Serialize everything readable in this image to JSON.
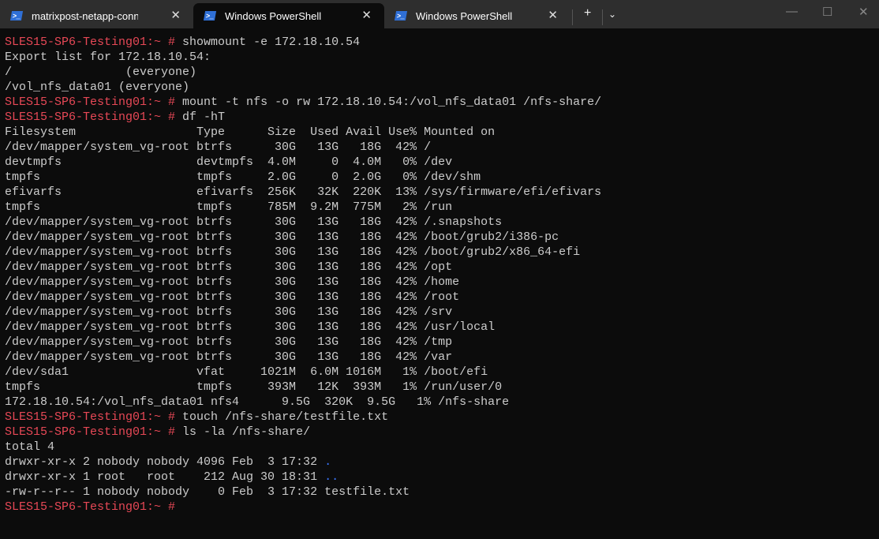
{
  "tabs": [
    {
      "label": "matrixpost-netapp-connector(",
      "active": false
    },
    {
      "label": "Windows PowerShell",
      "active": true
    },
    {
      "label": "Windows PowerShell",
      "active": false
    }
  ],
  "colors": {
    "prompt": "#e74856",
    "dir": "#3b78ff",
    "text": "#cccccc",
    "bg": "#0c0c0c"
  },
  "terminal_lines": [
    [
      {
        "t": "SLES15-SP6-Testing01:~ #",
        "c": "r"
      },
      {
        "t": " showmount -e 172.18.10.54"
      }
    ],
    [
      {
        "t": "Export list for 172.18.10.54:"
      }
    ],
    [
      {
        "t": "/                (everyone)"
      }
    ],
    [
      {
        "t": "/vol_nfs_data01 (everyone)"
      }
    ],
    [
      {
        "t": "SLES15-SP6-Testing01:~ #",
        "c": "r"
      },
      {
        "t": " mount -t nfs -o rw 172.18.10.54:/vol_nfs_data01 /nfs-share/"
      }
    ],
    [
      {
        "t": "SLES15-SP6-Testing01:~ #",
        "c": "r"
      },
      {
        "t": " df -hT"
      }
    ],
    [
      {
        "t": "Filesystem                 Type      Size  Used Avail Use% Mounted on"
      }
    ],
    [
      {
        "t": "/dev/mapper/system_vg-root btrfs      30G   13G   18G  42% /"
      }
    ],
    [
      {
        "t": "devtmpfs                   devtmpfs  4.0M     0  4.0M   0% /dev"
      }
    ],
    [
      {
        "t": "tmpfs                      tmpfs     2.0G     0  2.0G   0% /dev/shm"
      }
    ],
    [
      {
        "t": "efivarfs                   efivarfs  256K   32K  220K  13% /sys/firmware/efi/efivars"
      }
    ],
    [
      {
        "t": "tmpfs                      tmpfs     785M  9.2M  775M   2% /run"
      }
    ],
    [
      {
        "t": "/dev/mapper/system_vg-root btrfs      30G   13G   18G  42% /.snapshots"
      }
    ],
    [
      {
        "t": "/dev/mapper/system_vg-root btrfs      30G   13G   18G  42% /boot/grub2/i386-pc"
      }
    ],
    [
      {
        "t": "/dev/mapper/system_vg-root btrfs      30G   13G   18G  42% /boot/grub2/x86_64-efi"
      }
    ],
    [
      {
        "t": "/dev/mapper/system_vg-root btrfs      30G   13G   18G  42% /opt"
      }
    ],
    [
      {
        "t": "/dev/mapper/system_vg-root btrfs      30G   13G   18G  42% /home"
      }
    ],
    [
      {
        "t": "/dev/mapper/system_vg-root btrfs      30G   13G   18G  42% /root"
      }
    ],
    [
      {
        "t": "/dev/mapper/system_vg-root btrfs      30G   13G   18G  42% /srv"
      }
    ],
    [
      {
        "t": "/dev/mapper/system_vg-root btrfs      30G   13G   18G  42% /usr/local"
      }
    ],
    [
      {
        "t": "/dev/mapper/system_vg-root btrfs      30G   13G   18G  42% /tmp"
      }
    ],
    [
      {
        "t": "/dev/mapper/system_vg-root btrfs      30G   13G   18G  42% /var"
      }
    ],
    [
      {
        "t": "/dev/sda1                  vfat     1021M  6.0M 1016M   1% /boot/efi"
      }
    ],
    [
      {
        "t": "tmpfs                      tmpfs     393M   12K  393M   1% /run/user/0"
      }
    ],
    [
      {
        "t": "172.18.10.54:/vol_nfs_data01 nfs4      9.5G  320K  9.5G   1% /nfs-share"
      }
    ],
    [
      {
        "t": "SLES15-SP6-Testing01:~ #",
        "c": "r"
      },
      {
        "t": " touch /nfs-share/testfile.txt"
      }
    ],
    [
      {
        "t": "SLES15-SP6-Testing01:~ #",
        "c": "r"
      },
      {
        "t": " ls -la /nfs-share/"
      }
    ],
    [
      {
        "t": "total 4"
      }
    ],
    [
      {
        "t": "drwxr-xr-x 2 nobody nobody 4096 Feb  3 17:32 "
      },
      {
        "t": ".",
        "c": "b"
      }
    ],
    [
      {
        "t": "drwxr-xr-x 1 root   root    212 Aug 30 18:31 "
      },
      {
        "t": "..",
        "c": "b"
      }
    ],
    [
      {
        "t": "-rw-r--r-- 1 nobody nobody    0 Feb  3 17:32 testfile.txt"
      }
    ],
    [
      {
        "t": "SLES15-SP6-Testing01:~ #",
        "c": "r"
      },
      {
        "t": " "
      }
    ]
  ]
}
